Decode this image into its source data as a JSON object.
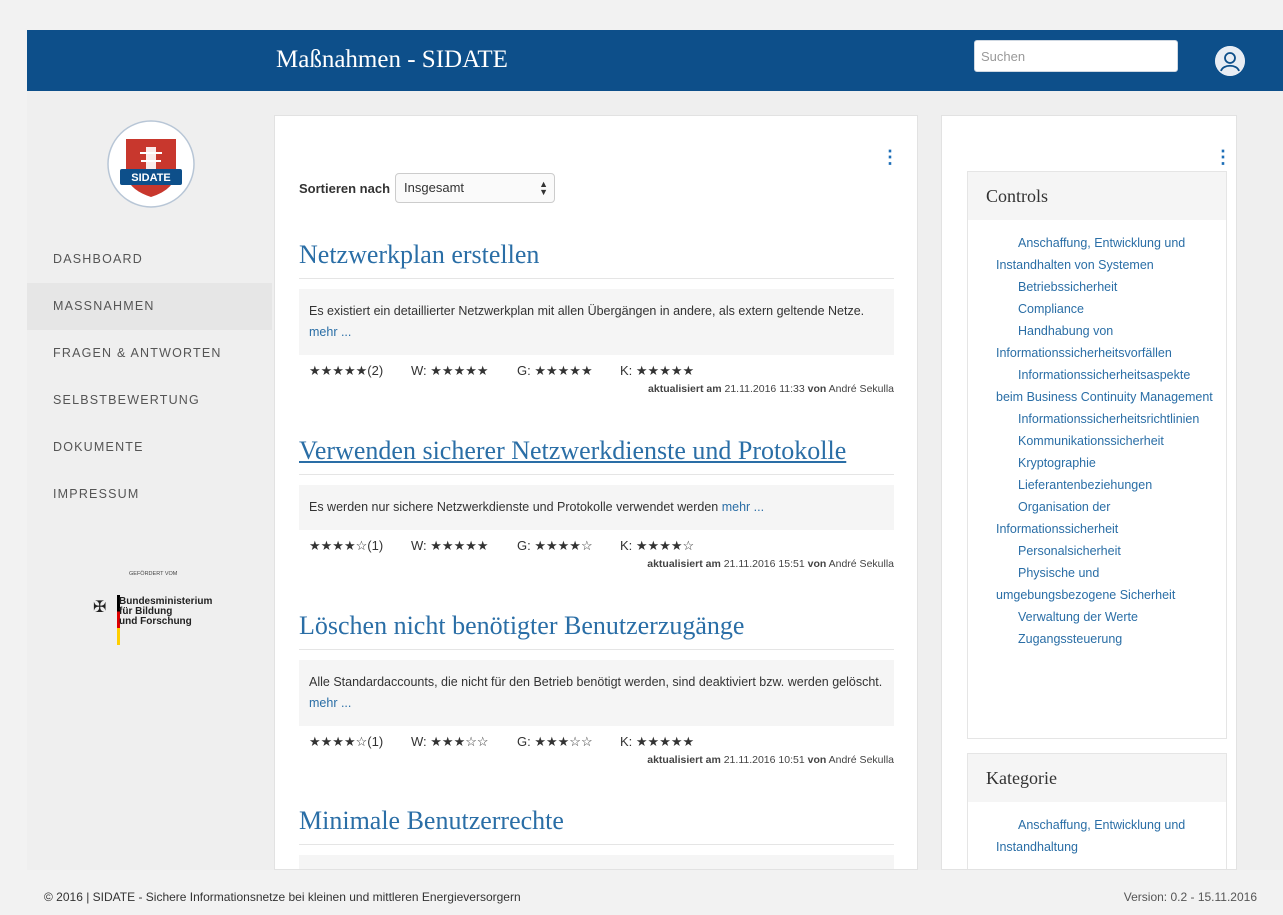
{
  "header": {
    "title": "Maßnahmen - SIDATE",
    "search_placeholder": "Suchen"
  },
  "logo": {
    "text": "SIDATE"
  },
  "sidebar": {
    "items": [
      {
        "label": "DASHBOARD",
        "active": false
      },
      {
        "label": "MASSNAHMEN",
        "active": true
      },
      {
        "label": "FRAGEN & ANTWORTEN",
        "active": false
      },
      {
        "label": "SELBSTBEWERTUNG",
        "active": false
      },
      {
        "label": "DOKUMENTE",
        "active": false
      },
      {
        "label": "IMPRESSUM",
        "active": false
      }
    ],
    "sponsor": {
      "small": "GEFÖRDERT VOM",
      "line1": "Bundesministerium",
      "line2": "für Bildung",
      "line3": "und Forschung"
    }
  },
  "main": {
    "sort_label": "Sortieren nach",
    "sort_value": "Insgesamt",
    "items": [
      {
        "title": "Netzwerkplan erstellen",
        "description": "Es existiert ein detaillierter Netzwerkplan mit allen Übergängen in andere, als extern geltende Netze.",
        "more": "mehr ...",
        "rating": "★★★★★(2)",
        "w": "W: ★★★★★",
        "g": "G: ★★★★★",
        "k": "K: ★★★★★",
        "updated_label": "aktualisiert am",
        "updated_date": "21.11.2016 11:33",
        "by_label": "von",
        "author": "André Sekulla"
      },
      {
        "title": "Verwenden sicherer Netzwerkdienste und Protokolle",
        "description": "Es werden nur sichere Netzwerkdienste und Protokolle verwendet werden",
        "more": "mehr ...",
        "rating": "★★★★☆(1)",
        "w": "W: ★★★★★",
        "g": "G: ★★★★☆",
        "k": "K: ★★★★☆",
        "updated_label": "aktualisiert am",
        "updated_date": "21.11.2016 15:51",
        "by_label": "von",
        "author": "André Sekulla"
      },
      {
        "title": "Löschen nicht benötigter Benutzerzugänge",
        "description": "Alle Standardaccounts, die nicht für den Betrieb benötigt werden, sind deaktiviert bzw. werden gelöscht.",
        "more": "mehr ...",
        "rating": "★★★★☆(1)",
        "w": "W: ★★★☆☆",
        "g": "G: ★★★☆☆",
        "k": "K: ★★★★★",
        "updated_label": "aktualisiert am",
        "updated_date": "21.11.2016 10:51",
        "by_label": "von",
        "author": "André Sekulla"
      },
      {
        "title": "Minimale Benutzerrechte"
      }
    ]
  },
  "controls": {
    "title": "Controls",
    "items": [
      "Anschaffung, Entwicklung und Instandhalten von Systemen",
      "Betriebssicherheit",
      "Compliance",
      "Handhabung von Informationssicherheitsvorfällen",
      "Informationssicherheitsaspekte beim Business Continuity Management",
      "Informationssicherheitsrichtlinien",
      "Kommunikationssicherheit",
      "Kryptographie",
      "Lieferantenbeziehungen",
      "Organisation der Informationssicherheit",
      "Personalsicherheit",
      "Physische und umgebungsbezogene Sicherheit",
      "Verwaltung der Werte",
      "Zugangssteuerung"
    ]
  },
  "kategorie": {
    "title": "Kategorie",
    "items": [
      "Anschaffung, Entwicklung und Instandhaltung"
    ]
  },
  "footer": {
    "copyright": "© 2016 | SIDATE - Sichere Informationsnetze bei kleinen und mittleren Energieversorgern",
    "version": "Version: 0.2 - 15.11.2016"
  }
}
